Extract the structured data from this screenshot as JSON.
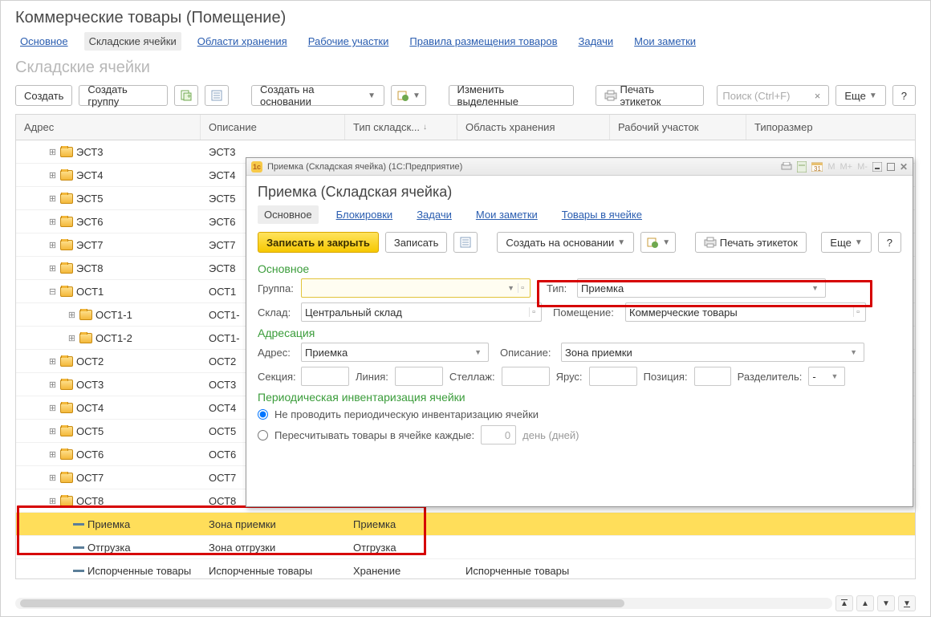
{
  "page": {
    "title": "Коммерческие товары (Помещение)",
    "section": "Складские ячейки"
  },
  "tabs": {
    "main": "Основное",
    "cells": "Складские ячейки",
    "areas": "Области хранения",
    "workareas": "Рабочие участки",
    "rules": "Правила размещения товаров",
    "tasks": "Задачи",
    "notes": "Мои заметки"
  },
  "toolbar": {
    "create": "Создать",
    "create_group": "Создать группу",
    "create_based": "Создать на основании",
    "change_selected": "Изменить выделенные",
    "print_labels": "Печать этикеток",
    "search_placeholder": "Поиск (Ctrl+F)",
    "more": "Еще",
    "help": "?"
  },
  "columns": {
    "addr": "Адрес",
    "desc": "Описание",
    "type": "Тип складск...",
    "area": "Область хранения",
    "work": "Рабочий участок",
    "size": "Типоразмер"
  },
  "rows": [
    {
      "lvl": 0,
      "exp": "+",
      "ic": "folder",
      "addr": "ЭСТ3",
      "desc": "ЭСТ3"
    },
    {
      "lvl": 0,
      "exp": "+",
      "ic": "folder",
      "addr": "ЭСТ4",
      "desc": "ЭСТ4"
    },
    {
      "lvl": 0,
      "exp": "+",
      "ic": "folder",
      "addr": "ЭСТ5",
      "desc": "ЭСТ5"
    },
    {
      "lvl": 0,
      "exp": "+",
      "ic": "folder",
      "addr": "ЭСТ6",
      "desc": "ЭСТ6"
    },
    {
      "lvl": 0,
      "exp": "+",
      "ic": "folder",
      "addr": "ЭСТ7",
      "desc": "ЭСТ7"
    },
    {
      "lvl": 0,
      "exp": "+",
      "ic": "folder",
      "addr": "ЭСТ8",
      "desc": "ЭСТ8"
    },
    {
      "lvl": 0,
      "exp": "-",
      "ic": "folder",
      "addr": "ОСТ1",
      "desc": "ОСТ1"
    },
    {
      "lvl": 1,
      "exp": "+",
      "ic": "folder",
      "addr": "ОСТ1-1",
      "desc": "ОСТ1-"
    },
    {
      "lvl": 1,
      "exp": "+",
      "ic": "folder",
      "addr": "ОСТ1-2",
      "desc": "ОСТ1-"
    },
    {
      "lvl": 0,
      "exp": "+",
      "ic": "folder",
      "addr": "ОСТ2",
      "desc": "ОСТ2"
    },
    {
      "lvl": 0,
      "exp": "+",
      "ic": "folder",
      "addr": "ОСТ3",
      "desc": "ОСТ3"
    },
    {
      "lvl": 0,
      "exp": "+",
      "ic": "folder",
      "addr": "ОСТ4",
      "desc": "ОСТ4"
    },
    {
      "lvl": 0,
      "exp": "+",
      "ic": "folder",
      "addr": "ОСТ5",
      "desc": "ОСТ5"
    },
    {
      "lvl": 0,
      "exp": "+",
      "ic": "folder",
      "addr": "ОСТ6",
      "desc": "ОСТ6"
    },
    {
      "lvl": 0,
      "exp": "+",
      "ic": "folder",
      "addr": "ОСТ7",
      "desc": "ОСТ7"
    },
    {
      "lvl": 0,
      "exp": "+",
      "ic": "folder",
      "addr": "ОСТ8",
      "desc": "ОСТ8"
    },
    {
      "lvl": 2,
      "ic": "dash",
      "addr": "Приемка",
      "desc": "Зона приемки",
      "type": "Приемка",
      "sel": true
    },
    {
      "lvl": 2,
      "ic": "dash",
      "addr": "Отгрузка",
      "desc": "Зона отгрузки",
      "type": "Отгрузка"
    },
    {
      "lvl": 2,
      "ic": "dash",
      "addr": "Испорченные товары",
      "desc": "Испорченные товары",
      "type": "Хранение",
      "area": "Испорченные товары"
    }
  ],
  "dialog": {
    "titlebar": "Приемка (Складская ячейка)  (1С:Предприятие)",
    "title": "Приемка (Складская ячейка)",
    "tabs": {
      "main": "Основное",
      "locks": "Блокировки",
      "tasks": "Задачи",
      "notes": "Мои заметки",
      "goods": "Товары в ячейке"
    },
    "toolbar": {
      "write_close": "Записать и закрыть",
      "write": "Записать",
      "create_based": "Создать на основании",
      "print_labels": "Печать этикеток",
      "more": "Еще",
      "help": "?"
    },
    "group_main": "Основное",
    "group_addr": "Адресация",
    "group_inv": "Периодическая инвентаризация ячейки",
    "labels": {
      "group": "Группа:",
      "type": "Тип:",
      "warehouse": "Склад:",
      "room": "Помещение:",
      "addr": "Адрес:",
      "desc": "Описание:",
      "section": "Секция:",
      "line": "Линия:",
      "rack": "Стеллаж:",
      "tier": "Ярус:",
      "position": "Позиция:",
      "separator": "Разделитель:"
    },
    "values": {
      "group": "",
      "type": "Приемка",
      "warehouse": "Центральный склад",
      "room": "Коммерческие товары",
      "addr": "Приемка",
      "desc": "Зона приемки",
      "section": "",
      "line": "",
      "rack": "",
      "tier": "",
      "position": "",
      "separator": "-",
      "count_every": "0",
      "count_unit": "день (дней)"
    },
    "radio": {
      "no_inv": "Не проводить периодическую инвентаризацию ячейки",
      "recount": "Пересчитывать товары в ячейке каждые:"
    }
  }
}
